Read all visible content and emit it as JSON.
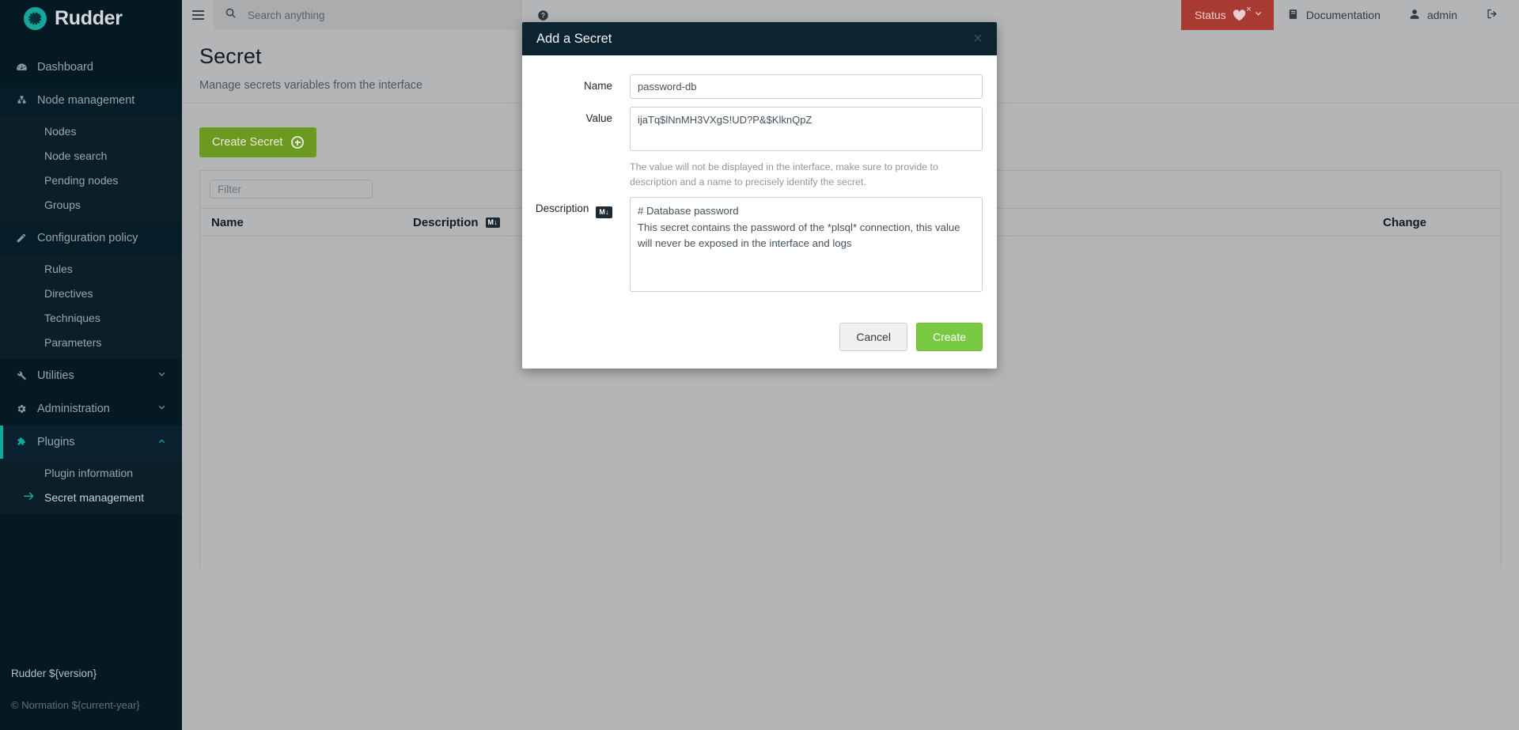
{
  "brand": {
    "name": "Rudder",
    "logo_icon": "rudder-gear-icon"
  },
  "sidebar": {
    "items": [
      {
        "label": "Dashboard",
        "icon": "dashboard-gauge-icon"
      },
      {
        "label": "Node management",
        "icon": "sitemap-icon"
      },
      {
        "label": "Nodes"
      },
      {
        "label": "Node search"
      },
      {
        "label": "Pending nodes"
      },
      {
        "label": "Groups"
      },
      {
        "label": "Configuration policy",
        "icon": "pencil-icon"
      },
      {
        "label": "Rules"
      },
      {
        "label": "Directives"
      },
      {
        "label": "Techniques"
      },
      {
        "label": "Parameters"
      },
      {
        "label": "Utilities",
        "icon": "wrench-icon",
        "caret": "chevron-down-icon"
      },
      {
        "label": "Administration",
        "icon": "gear-icon",
        "caret": "chevron-down-icon"
      },
      {
        "label": "Plugins",
        "icon": "puzzle-icon",
        "caret": "chevron-up-icon"
      },
      {
        "label": "Plugin information"
      },
      {
        "label": "Secret management",
        "icon": "arrow-right-icon"
      }
    ],
    "footer": {
      "version": "Rudder ${version}",
      "copyright": "© Normation ${current-year}"
    }
  },
  "topbar": {
    "menu_icon": "hamburger-icon",
    "search": {
      "placeholder": "Search anything",
      "value": "",
      "icon": "search-icon"
    },
    "help_icon": "help-circle-icon",
    "status": {
      "label": "Status",
      "icon": "heartbeat-icon",
      "error_mark": "×",
      "caret": "chevron-down-icon",
      "color": "#a83a32"
    },
    "documentation": {
      "label": "Documentation",
      "icon": "book-icon"
    },
    "user": {
      "label": "admin",
      "icon": "user-icon"
    },
    "logout_icon": "sign-out-icon"
  },
  "page": {
    "title": "Secret",
    "subtitle": "Manage secrets variables from the interface",
    "create_button": {
      "label": "Create Secret",
      "icon": "plus-circle-icon"
    },
    "filter": {
      "placeholder": "Filter",
      "value": ""
    },
    "table": {
      "columns": [
        "Name",
        "Description",
        "Change"
      ],
      "description_badge": "M↓",
      "rows": []
    }
  },
  "modal": {
    "title": "Add a Secret",
    "close_icon": "close-icon",
    "fields": {
      "name": {
        "label": "Name",
        "value": "password-db"
      },
      "value": {
        "label": "Value",
        "value": "ijaTq$lNnMH3VXgS!UD?P&$KlknQpZ",
        "help": "The value will not be displayed in the interface, make sure to provide to description and a name to precisely identify the secret."
      },
      "description": {
        "label": "Description",
        "badge": "M↓",
        "value": "# Database password\nThis secret contains the password of the *plsql* connection, this value will never be exposed in the interface and logs"
      }
    },
    "buttons": {
      "cancel": "Cancel",
      "create": "Create"
    }
  },
  "colors": {
    "brand_teal": "#13a8a0",
    "create_green": "#6c991f",
    "modal_green": "#7ac943",
    "status_red": "#a83a32",
    "sidebar_dark": "#041922"
  }
}
